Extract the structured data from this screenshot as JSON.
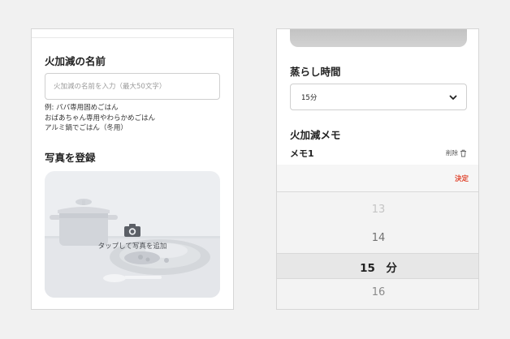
{
  "left": {
    "name_heading": "火加減の名前",
    "name_placeholder": "火加減の名前を入力（最大50文字）",
    "examples": [
      "例: パパ専用固めごはん",
      "おばあちゃん専用やわらかめごはん",
      "アルミ鍋でごはん（冬用）"
    ],
    "photo_heading": "写真を登録",
    "photo_label": "タップして写真を追加"
  },
  "right": {
    "steam_heading": "蒸らし時間",
    "steam_value": "15分",
    "memo_heading": "火加減メモ",
    "memo_label": "メモ1",
    "delete_label": "削除",
    "picker": {
      "confirm_label": "決定",
      "items": [
        "13",
        "14",
        "15　分",
        "16"
      ]
    }
  },
  "colors": {
    "accent_red": "#e0452e",
    "panel_bg": "#ffffff",
    "page_bg": "#f1f1f1"
  },
  "icons": {
    "camera": "camera-icon",
    "chevron": "chevron-down-icon",
    "trash": "trash-icon"
  }
}
